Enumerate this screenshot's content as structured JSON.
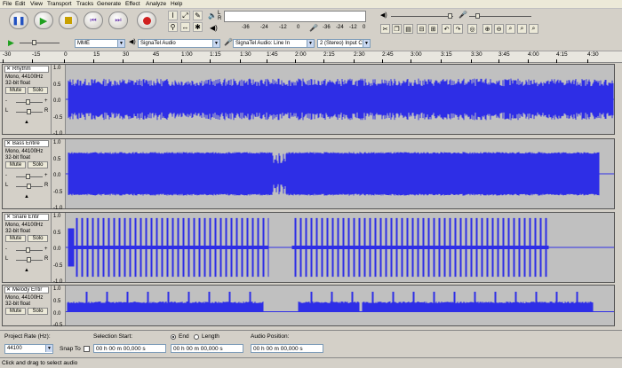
{
  "menu": [
    "File",
    "Edit",
    "View",
    "Transport",
    "Tracks",
    "Generate",
    "Effect",
    "Analyze",
    "Help"
  ],
  "toolbar": {
    "meter_ticks": [
      "-36",
      "-24",
      "-12",
      "0"
    ],
    "meter_lr": [
      "L",
      "R"
    ],
    "host": "MME",
    "output_device": "SignaTel Audio",
    "input_device": "SignaTel Audio: Line In",
    "channels": "2 (Stereo) Input C"
  },
  "ruler": [
    "-30",
    "-15",
    "0",
    "15",
    "30",
    "45",
    "1:00",
    "1:15",
    "1:30",
    "1:45",
    "2:00",
    "2:15",
    "2:30",
    "2:45",
    "3:00",
    "3:15",
    "3:30",
    "3:45",
    "4:00",
    "4:15",
    "4:30"
  ],
  "tracks": [
    {
      "name": "Rhythm",
      "format": "Mono, 44100Hz",
      "bits": "32-bit float",
      "mute": "Mute",
      "solo": "Solo",
      "scale": [
        "1.0",
        "0.5",
        "0.0",
        "-0.5",
        "-1.0"
      ],
      "lr": [
        "L",
        "R"
      ]
    },
    {
      "name": "Bass Entire",
      "format": "Mono, 44100Hz",
      "bits": "32-bit float",
      "mute": "Mute",
      "solo": "Solo",
      "scale": [
        "1.0",
        "0.5",
        "0.0",
        "-0.5",
        "-1.0"
      ],
      "lr": [
        "L",
        "R"
      ]
    },
    {
      "name": "Snare Entir",
      "format": "Mono, 44100Hz",
      "bits": "32-bit float",
      "mute": "Mute",
      "solo": "Solo",
      "scale": [
        "1.0",
        "0.5",
        "0.0",
        "-0.5",
        "-1.0"
      ],
      "lr": [
        "L",
        "R"
      ]
    },
    {
      "name": "Melody Entir",
      "format": "Mono, 44100Hz",
      "bits": "32-bit float",
      "mute": "Mute",
      "solo": "Solo",
      "scale": [
        "1.0",
        "0.5",
        "0.0",
        "-0.5"
      ],
      "lr": [
        "L",
        "R"
      ]
    }
  ],
  "bottom": {
    "rate_label": "Project Rate (Hz):",
    "rate_value": "44100",
    "snap_label": "Snap To",
    "sel_label": "Selection Start:",
    "end_label": "End",
    "length_label": "Length",
    "pos_label": "Audio Position:",
    "sel_value": "00 h 00 m 00,000 s",
    "end_value": "00 h 00 m 00,000 s",
    "pos_value": "00 h 00 m 00,000 s"
  },
  "status": "Click and drag to select audio",
  "colors": {
    "wave": "#2e2ee6",
    "wave_dark": "#1414a0"
  }
}
